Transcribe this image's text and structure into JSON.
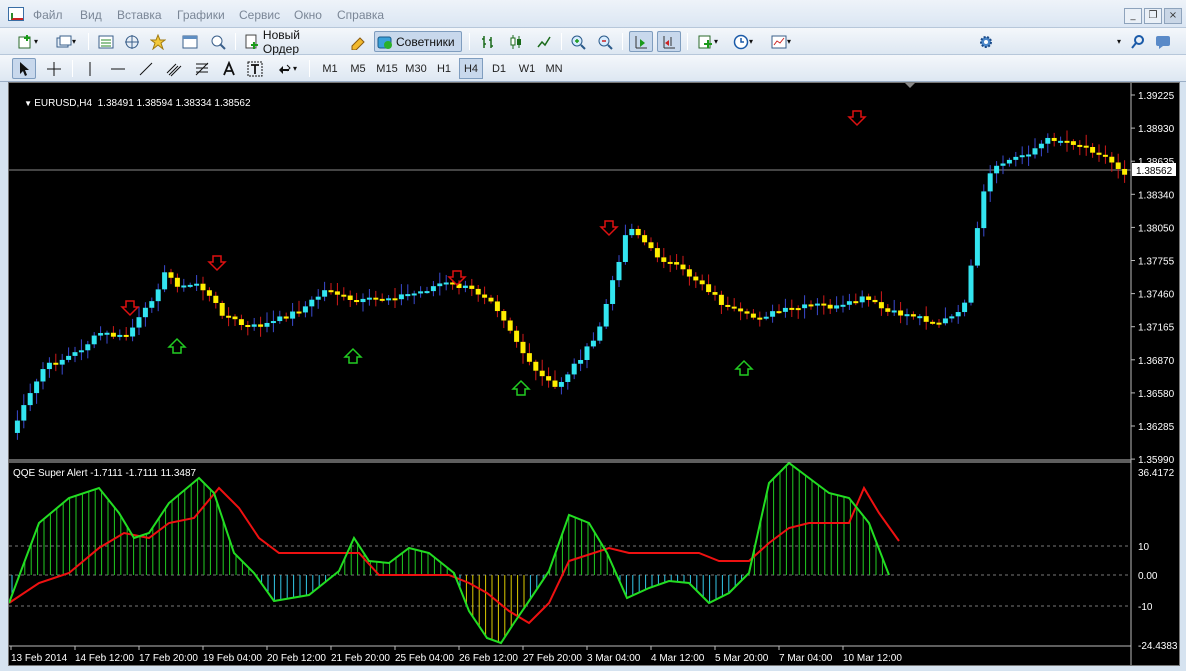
{
  "menu": {
    "items": [
      "Файл",
      "Вид",
      "Вставка",
      "Графики",
      "Сервис",
      "Окно",
      "Справка"
    ],
    "window_buttons": [
      "_",
      "❐",
      "×"
    ]
  },
  "toolbar": {
    "new_order_label": "Новый Ордер",
    "experts_label": "Советники",
    "search_value": ""
  },
  "timeframes": [
    "M1",
    "M5",
    "M15",
    "M30",
    "H1",
    "H4",
    "D1",
    "W1",
    "MN"
  ],
  "selected_timeframe": "H4",
  "chart": {
    "symbol_header": "EURUSD,H4  1.38491 1.38594 1.38334 1.38562",
    "current_price_label": "1.38562",
    "price_axis": [
      "1.39225",
      "1.38930",
      "1.38635",
      "1.38340",
      "1.38050",
      "1.37755",
      "1.37460",
      "1.37165",
      "1.36870",
      "1.36580",
      "1.36285",
      "1.35990"
    ],
    "time_axis": [
      "13 Feb 2014",
      "14 Feb 12:00",
      "17 Feb 20:00",
      "19 Feb 04:00",
      "20 Feb 12:00",
      "21 Feb 20:00",
      "25 Feb 04:00",
      "26 Feb 12:00",
      "27 Feb 20:00",
      "3 Mar 04:00",
      "4 Mar 12:00",
      "5 Mar 20:00",
      "7 Mar 04:00",
      "10 Mar 12:00"
    ],
    "colors": {
      "bull": "#33e5f0",
      "bear": "#ffee00",
      "buy_arrow": "#22cc22",
      "sell_arrow": "#dd1111",
      "background": "#000000"
    }
  },
  "indicator": {
    "title": "QQE Super Alert -1.7111 -1.7111 11.3487",
    "axis": [
      "36.4172",
      "10",
      "0.00",
      "-10",
      "-24.4383"
    ],
    "colors": {
      "fast": "#22dd22",
      "slow": "#ee1111",
      "hist_pos": "#22cc22",
      "hist_neg": "#33c8e8",
      "hist_extreme_neg": "#ddcc00"
    }
  },
  "icons": [
    "new-chart-icon",
    "profiles-icon",
    "market-watch-icon",
    "navigator-icon",
    "favorites-icon",
    "terminal-icon",
    "tester-icon",
    "new-order-icon",
    "meta-editor-icon",
    "experts-icon",
    "bar-chart-icon",
    "candlestick-icon",
    "line-chart-icon",
    "zoom-in-icon",
    "zoom-out-icon",
    "auto-scroll-icon",
    "chart-shift-icon",
    "indicators-icon",
    "periods-icon",
    "templates-icon",
    "settings-gear-icon",
    "search-icon",
    "chat-icon",
    "cursor-icon",
    "crosshair-icon",
    "vertical-line-icon",
    "horizontal-line-icon",
    "trendline-icon",
    "fibonacci-icon",
    "channel-icon",
    "text-icon",
    "text-label-icon",
    "arrows-icon"
  ]
}
